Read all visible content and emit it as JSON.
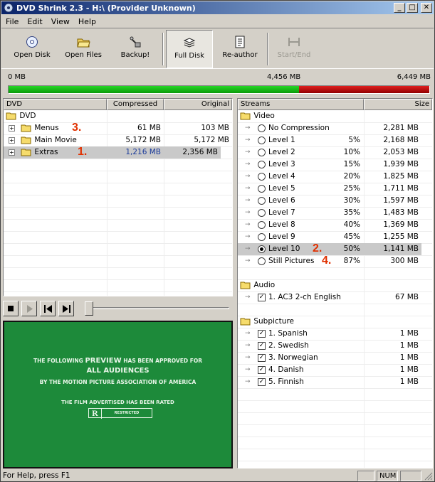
{
  "window": {
    "title": "DVD Shrink 2.3 - H:\\ (Provider Unknown)"
  },
  "menu": [
    "File",
    "Edit",
    "View",
    "Help"
  ],
  "toolbar": [
    {
      "label": "Open Disk",
      "icon": "disc-icon",
      "state": "normal"
    },
    {
      "label": "Open Files",
      "icon": "folder-open-icon",
      "state": "normal"
    },
    {
      "label": "Backup!",
      "icon": "backup-icon",
      "state": "normal"
    },
    {
      "label": "Full Disk",
      "icon": "stack-icon",
      "state": "pressed"
    },
    {
      "label": "Re-author",
      "icon": "document-list-icon",
      "state": "normal"
    },
    {
      "label": "Start/End",
      "icon": "start-end-icon",
      "state": "disabled"
    }
  ],
  "sizebar": {
    "min_label": "0 MB",
    "mid_label": "4,456 MB",
    "max_label": "6,449 MB",
    "used_fraction": 0.691,
    "capacity_mb": 4456,
    "total_mb": 6449
  },
  "dvd": {
    "headers": [
      "DVD",
      "Compressed",
      "Original"
    ],
    "root": "DVD",
    "items": [
      {
        "label": "Menus",
        "compressed": "61 MB",
        "original": "103 MB",
        "annotation": "3."
      },
      {
        "label": "Main Movie",
        "compressed": "5,172 MB",
        "original": "5,172 MB",
        "annotation": ""
      },
      {
        "label": "Extras",
        "compressed": "1,216 MB",
        "original": "2,356 MB",
        "annotation": "1.",
        "selected": true
      }
    ]
  },
  "streams": {
    "headers": [
      "Streams",
      "Size"
    ],
    "video_label": "Video",
    "video": [
      {
        "label": "No Compression",
        "pct": "",
        "size": "2,281 MB"
      },
      {
        "label": "Level 1",
        "pct": "5%",
        "size": "2,168 MB"
      },
      {
        "label": "Level 2",
        "pct": "10%",
        "size": "2,053 MB"
      },
      {
        "label": "Level 3",
        "pct": "15%",
        "size": "1,939 MB"
      },
      {
        "label": "Level 4",
        "pct": "20%",
        "size": "1,825 MB"
      },
      {
        "label": "Level 5",
        "pct": "25%",
        "size": "1,711 MB"
      },
      {
        "label": "Level 6",
        "pct": "30%",
        "size": "1,597 MB"
      },
      {
        "label": "Level 7",
        "pct": "35%",
        "size": "1,483 MB"
      },
      {
        "label": "Level 8",
        "pct": "40%",
        "size": "1,369 MB"
      },
      {
        "label": "Level 9",
        "pct": "45%",
        "size": "1,255 MB"
      },
      {
        "label": "Level 10",
        "pct": "50%",
        "size": "1,141 MB",
        "selected": true,
        "annotation": "2."
      },
      {
        "label": "Still Pictures",
        "pct": "87%",
        "size": "300 MB",
        "annotation": "4."
      }
    ],
    "audio_label": "Audio",
    "audio": [
      {
        "label": "1. AC3 2-ch English",
        "size": "67 MB"
      }
    ],
    "subpicture_label": "Subpicture",
    "subpicture": [
      {
        "label": "1. Spanish",
        "size": "1 MB"
      },
      {
        "label": "2. Swedish",
        "size": "1 MB"
      },
      {
        "label": "3. Norwegian",
        "size": "1 MB"
      },
      {
        "label": "4. Danish",
        "size": "1 MB"
      },
      {
        "label": "5. Finnish",
        "size": "1 MB"
      }
    ]
  },
  "preview": {
    "line1a": "THE FOLLOWING ",
    "line1b": "PREVIEW",
    "line1c": " HAS BEEN APPROVED FOR",
    "line2": "ALL AUDIENCES",
    "line3": "BY THE MOTION PICTURE ASSOCIATION OF AMERICA",
    "line4": "THE FILM ADVERTISED HAS BEEN RATED",
    "rating": "R",
    "rating_box": "RESTRICTED"
  },
  "status": {
    "help": "For Help, press F1",
    "num": "NUM"
  },
  "colors": {
    "selected_row": "#c9c9c9",
    "annotation": "#e03000",
    "used_bar": "#14b814",
    "over_bar": "#c00000",
    "blue_value": "#1a3a9a"
  }
}
